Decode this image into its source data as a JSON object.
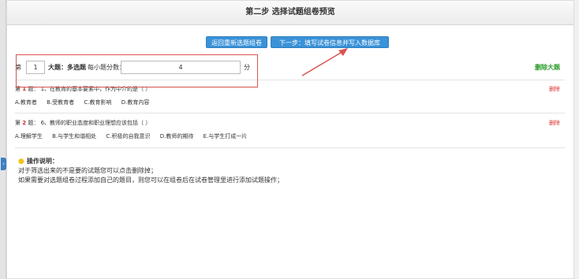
{
  "header": {
    "title": "第二步 选择试题组卷预览"
  },
  "toolbar": {
    "back_label": "返回重新选题组卷",
    "next_label": "下一步：填写试卷信息并写入数据库"
  },
  "part": {
    "prefix": "第",
    "number": "1",
    "type_label": "大题：多选题",
    "score_label": "每小题分数：",
    "score_value": "4",
    "unit": "分",
    "delete_label": "删除大题"
  },
  "questions": [
    {
      "prefix": "第",
      "number": "1",
      "suffix": "题：",
      "text": "1、在教育的基本要素中，作为中介的是（   ）",
      "delete_label": "删除",
      "options": [
        "A.教育者",
        "B.受教育者",
        "C.教育影响",
        "D.教育内容"
      ]
    },
    {
      "prefix": "第",
      "number": "2",
      "suffix": "题：",
      "text": "6、教师的职业态度和职业理想应该包括（   ）",
      "delete_label": "删除",
      "options": [
        "A.理解学生",
        "B.与学生和谐相处",
        "C.积极的自我意识",
        "D.教师的期待",
        "E.与学生打成一片"
      ]
    }
  ],
  "help": {
    "title": "操作说明：",
    "line1": "对于筛选出来的不是要的试题您可以点击删除掉；",
    "line2": "如果需要对选题组卷过程添加自己的题目，则您可以在组卷后在试卷管理里进行添加试题操作；"
  },
  "colors": {
    "accent_blue": "#3a92d8",
    "delete_red": "#d9302c",
    "delete_part_green": "#2a9d2a",
    "highlight_red": "#d9534f"
  }
}
